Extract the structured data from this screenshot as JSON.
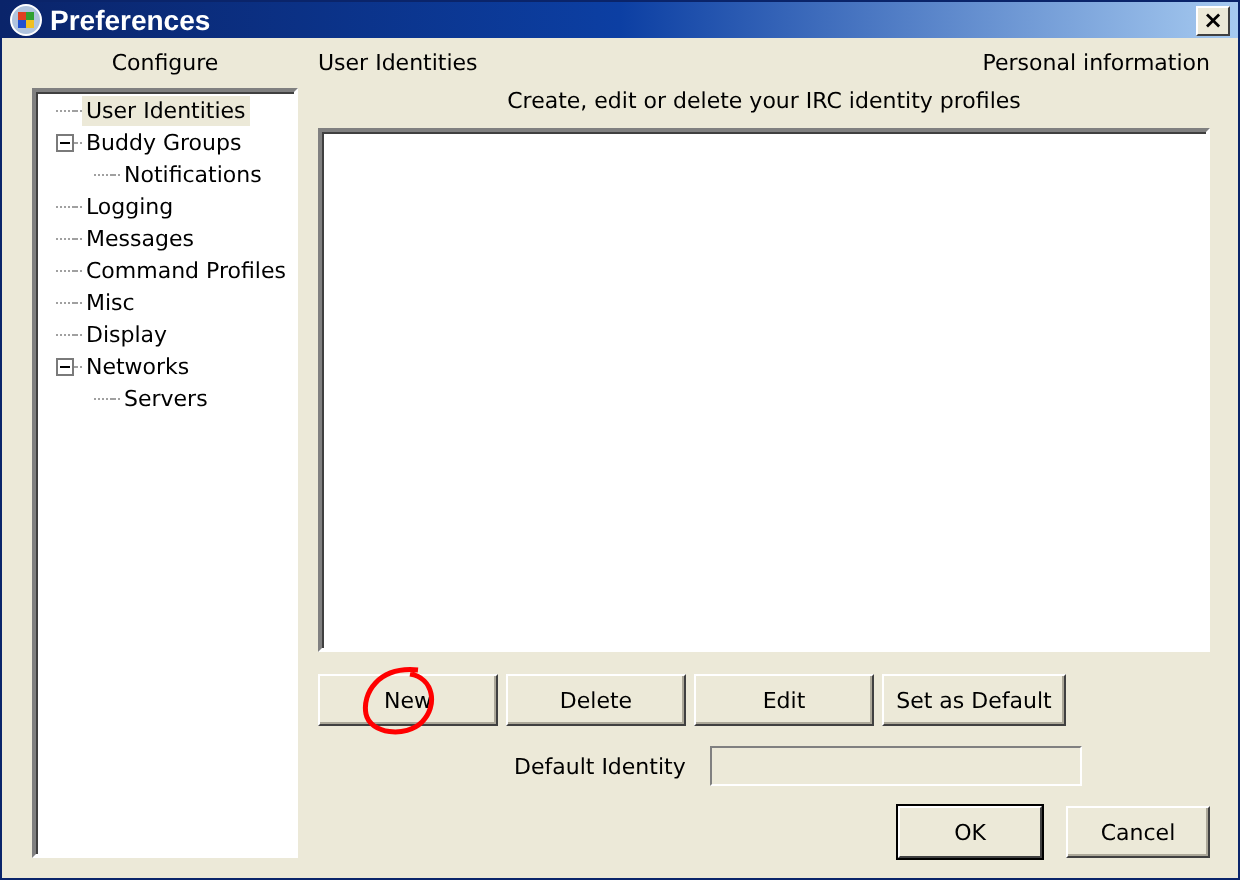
{
  "window": {
    "title": "Preferences",
    "close": "×"
  },
  "sidebar": {
    "heading": "Configure",
    "items": [
      {
        "label": "User Identities",
        "selected": true
      },
      {
        "label": "Buddy Groups",
        "selected": false,
        "expanded": true,
        "children": [
          {
            "label": "Notifications",
            "selected": false
          }
        ]
      },
      {
        "label": "Logging",
        "selected": false
      },
      {
        "label": "Messages",
        "selected": false
      },
      {
        "label": "Command Profiles",
        "selected": false
      },
      {
        "label": "Misc",
        "selected": false
      },
      {
        "label": "Display",
        "selected": false
      },
      {
        "label": "Networks",
        "selected": false,
        "expanded": true,
        "children": [
          {
            "label": "Servers",
            "selected": false
          }
        ]
      }
    ]
  },
  "panel": {
    "title": "User Identities",
    "subtitle": "Personal information",
    "description": "Create, edit or delete your IRC identity profiles",
    "buttons": [
      {
        "label": "New",
        "circled": true
      },
      {
        "label": "Delete",
        "circled": false
      },
      {
        "label": "Edit",
        "circled": false
      },
      {
        "label": "Set as Default",
        "circled": false
      }
    ],
    "default_identity": {
      "label": "Default Identity"
    }
  },
  "dialog_buttons": [
    {
      "label": "OK",
      "default": true
    },
    {
      "label": "Cancel",
      "default": false
    }
  ]
}
